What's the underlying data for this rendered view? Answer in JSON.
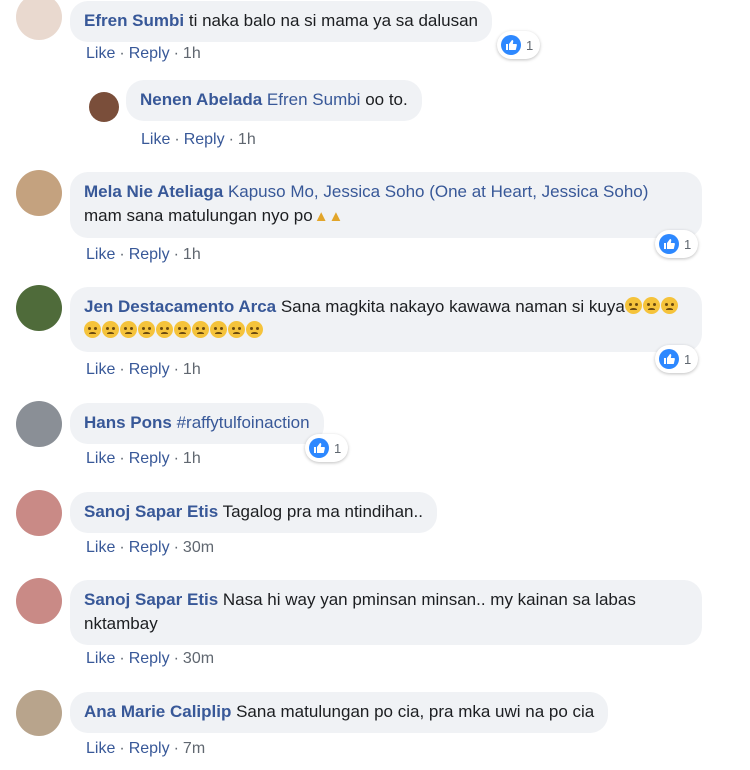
{
  "labels": {
    "like": "Like",
    "reply": "Reply",
    "sep": "·"
  },
  "colors": {
    "link": "#385898",
    "bubble": "#f0f2f5",
    "reaction": "#2d88ff",
    "meta": "#606770"
  },
  "comments": [
    {
      "author": "Efren Sumbi",
      "text": " ti naka balo na si mama ya sa dalusan",
      "time": "1h",
      "reactions": "1",
      "reaction_icon": "like-icon"
    },
    {
      "author": "Nenen Abelada",
      "mention": "Efren Sumbi",
      "text": " oo to.",
      "time": "1h"
    },
    {
      "author": "Mela Nie Ateliaga",
      "mention": "Kapuso Mo, Jessica Soho (One at Heart, Jessica Soho)",
      "text": " mam sana matulungan nyo po",
      "emoji": "folded-hands",
      "time": "1h",
      "reactions": "1"
    },
    {
      "author": "Jen Destacamento Arca",
      "text": " Sana magkita nakayo kawawa naman si kuya",
      "emoji": "sad-face",
      "time": "1h",
      "reactions": "1"
    },
    {
      "author": "Hans Pons",
      "mention": "#raffytulfoinaction",
      "time": "1h",
      "reactions": "1"
    },
    {
      "author": "Sanoj Sapar Etis",
      "text": " Tagalog pra ma ntindihan..",
      "time": "30m"
    },
    {
      "author": "Sanoj Sapar Etis",
      "text": " Nasa hi way yan pminsan minsan.. my kainan sa labas nktambay",
      "time": "30m"
    },
    {
      "author": "Ana Marie Caliplip",
      "text": " Sana matulungan po cia, pra mka uwi na po cia",
      "time": "7m"
    }
  ]
}
